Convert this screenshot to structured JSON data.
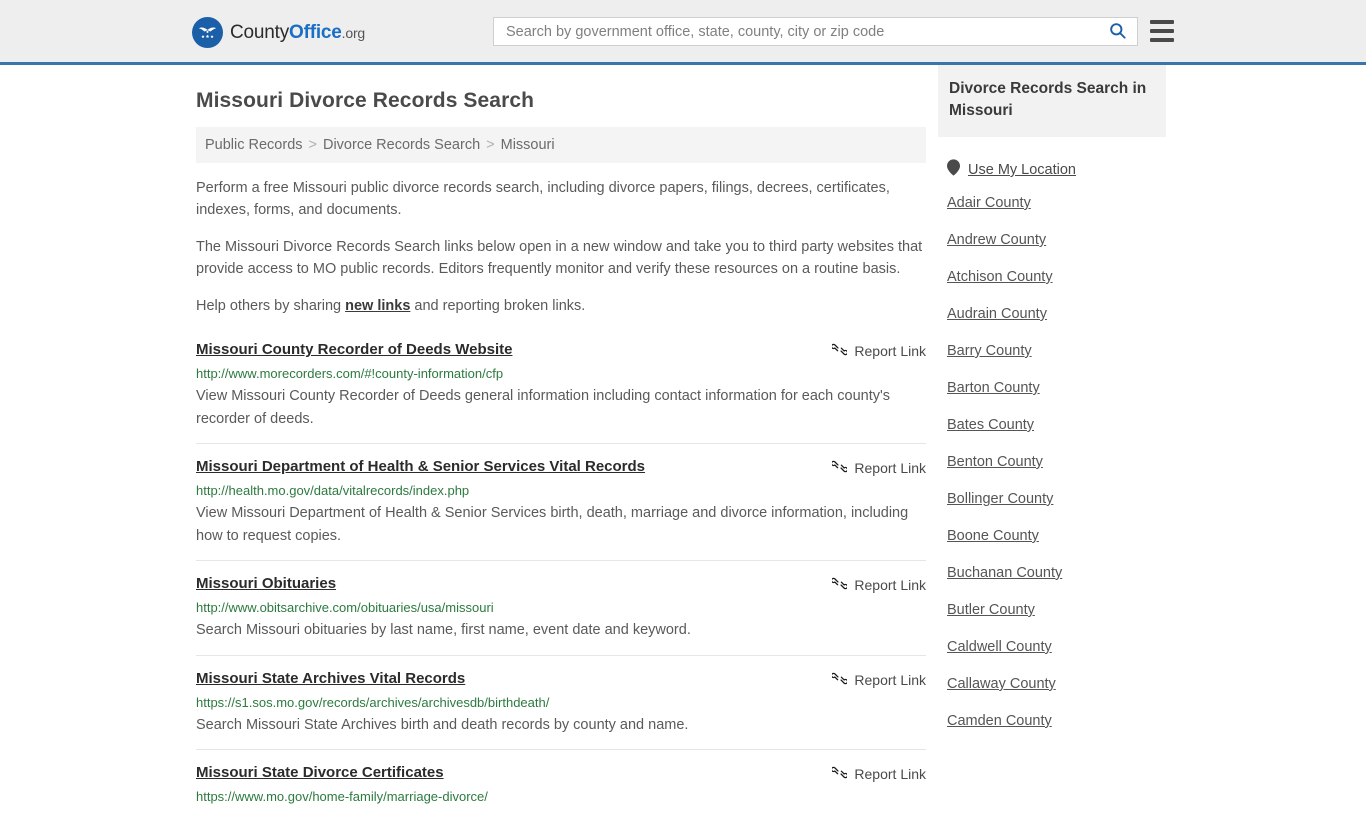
{
  "header": {
    "logo": {
      "part1": "County",
      "part2": "Office",
      "part3": ".org",
      "icon": "eagle-shield-logo"
    },
    "search": {
      "placeholder": "Search by government office, state, county, city or zip code",
      "value": "",
      "search_icon": "search-icon"
    },
    "menu_icon": "hamburger-menu-icon",
    "accent_color": "#3a75a8"
  },
  "page": {
    "title": "Missouri Divorce Records Search"
  },
  "breadcrumb": {
    "items": [
      {
        "label": "Public Records"
      },
      {
        "label": "Divorce Records Search"
      },
      {
        "label": "Missouri"
      }
    ],
    "separator": ">"
  },
  "intro": {
    "paragraph1": "Perform a free Missouri public divorce records search, including divorce papers, filings, decrees, certificates, indexes, forms, and documents.",
    "paragraph2": "The Missouri Divorce Records Search links below open in a new window and take you to third party websites that provide access to MO public records. Editors frequently monitor and verify these resources on a routine basis.",
    "paragraph3_before": "Help others by sharing ",
    "paragraph3_link": "new links",
    "paragraph3_after": " and reporting broken links."
  },
  "results": {
    "report_label": "Report Link",
    "report_icon": "broken-link-icon",
    "items": [
      {
        "title": "Missouri County Recorder of Deeds Website",
        "url": "http://www.morecorders.com/#!county-information/cfp",
        "description": "View Missouri County Recorder of Deeds general information including contact information for each county's recorder of deeds."
      },
      {
        "title": "Missouri Department of Health & Senior Services Vital Records",
        "url": "http://health.mo.gov/data/vitalrecords/index.php",
        "description": "View Missouri Department of Health & Senior Services birth, death, marriage and divorce information, including how to request copies."
      },
      {
        "title": "Missouri Obituaries",
        "url": "http://www.obitsarchive.com/obituaries/usa/missouri",
        "description": "Search Missouri obituaries by last name, first name, event date and keyword."
      },
      {
        "title": "Missouri State Archives Vital Records",
        "url": "https://s1.sos.mo.gov/records/archives/archivesdb/birthdeath/",
        "description": "Search Missouri State Archives birth and death records by county and name."
      },
      {
        "title": "Missouri State Divorce Certificates",
        "url": "https://www.mo.gov/home-family/marriage-divorce/",
        "description": ""
      }
    ]
  },
  "sidebar": {
    "heading": "Divorce Records Search in Missouri",
    "use_my_location": {
      "label": "Use My Location",
      "icon": "map-pin-icon"
    },
    "counties": [
      {
        "label": "Adair County"
      },
      {
        "label": "Andrew County"
      },
      {
        "label": "Atchison County"
      },
      {
        "label": "Audrain County"
      },
      {
        "label": "Barry County"
      },
      {
        "label": "Barton County"
      },
      {
        "label": "Bates County"
      },
      {
        "label": "Benton County"
      },
      {
        "label": "Bollinger County"
      },
      {
        "label": "Boone County"
      },
      {
        "label": "Buchanan County"
      },
      {
        "label": "Butler County"
      },
      {
        "label": "Caldwell County"
      },
      {
        "label": "Callaway County"
      },
      {
        "label": "Camden County"
      }
    ]
  }
}
